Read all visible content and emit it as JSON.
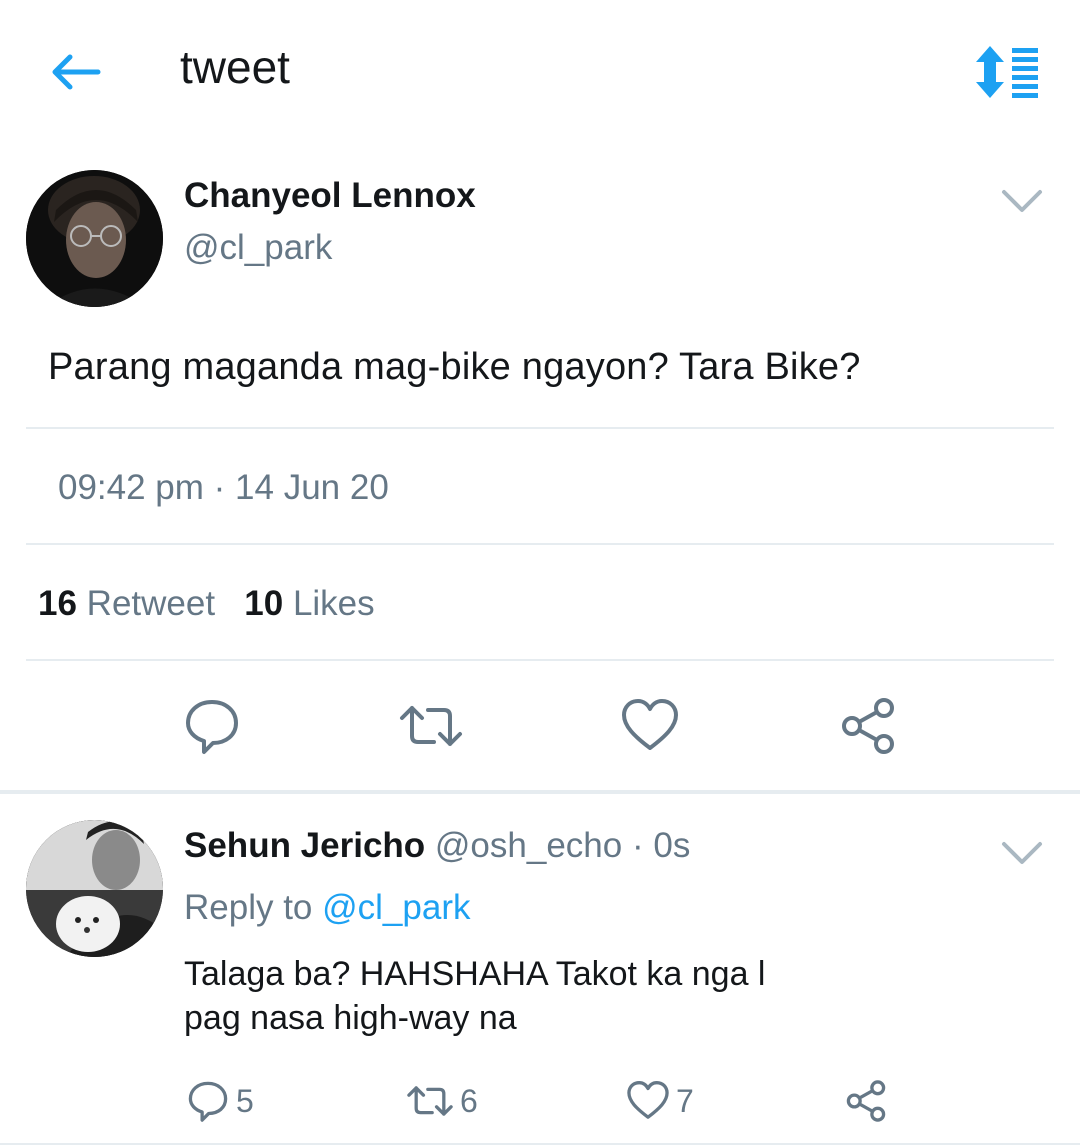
{
  "header": {
    "title": "tweet"
  },
  "tweet": {
    "name": "Chanyeol Lennox",
    "handle": "@cl_park",
    "text": "Parang maganda mag-bike ngayon? Tara Bike?",
    "time": "09:42 pm",
    "date_sep": " · ",
    "date": "14 Jun 20",
    "retweet_count": "16",
    "retweet_label": "Retweet",
    "like_count": "10",
    "like_label": "Likes"
  },
  "reply": {
    "name": "Sehun Jericho",
    "handle": "@osh_echo",
    "time": "· 0s",
    "reply_prefix": "Reply to ",
    "reply_to": "@cl_park",
    "text": "Talaga ba? HAHSHAHA Takot ka nga l\npag nasa high-way na",
    "reply_count": "5",
    "retweet_count": "6",
    "like_count": "7"
  },
  "icons": {
    "back": "arrow-left-icon",
    "sort": "sort-list-icon",
    "chevron": "chevron-down-icon",
    "reply": "comment-icon",
    "retweet": "retweet-icon",
    "like": "heart-icon",
    "share": "share-icon"
  },
  "colors": {
    "accent": "#1da1f2",
    "muted": "#657786",
    "text": "#14171a",
    "divider": "#e6ecf0"
  }
}
